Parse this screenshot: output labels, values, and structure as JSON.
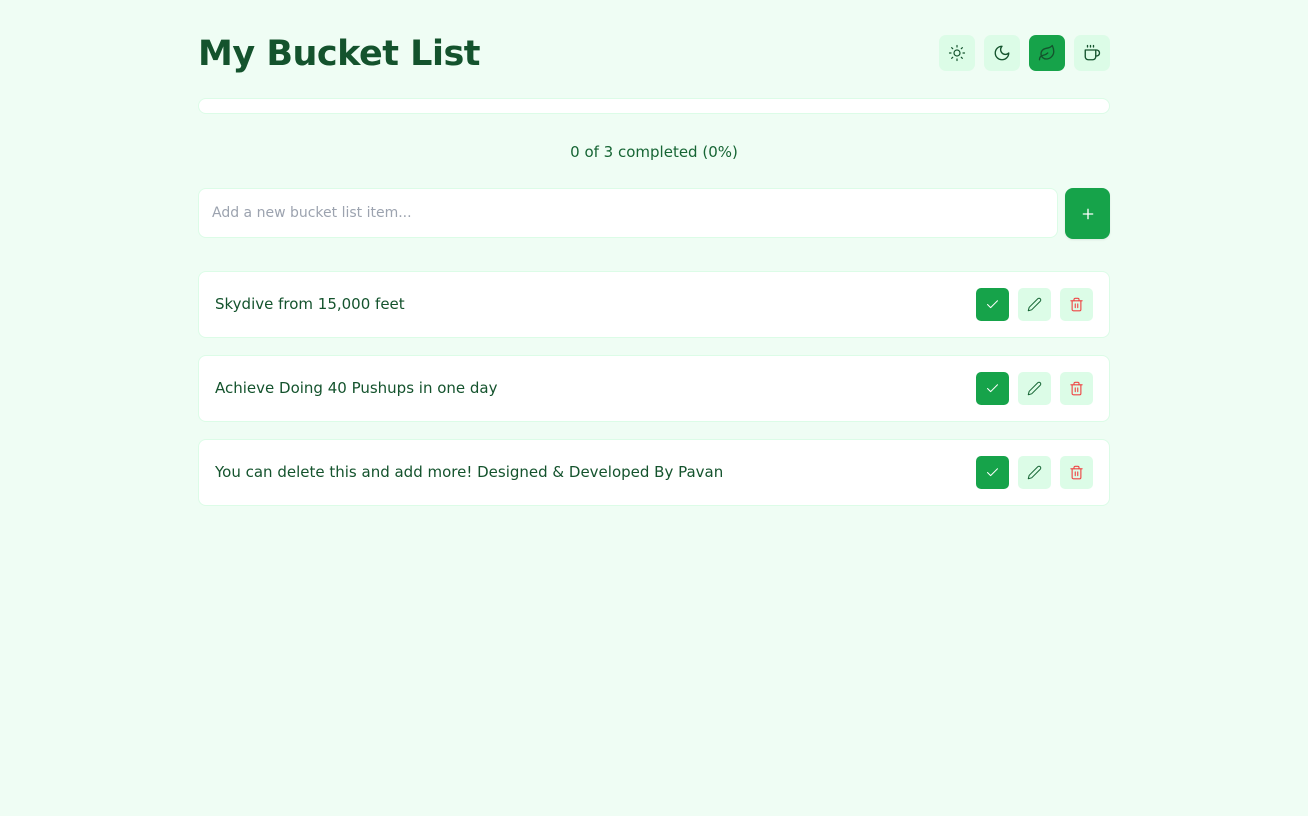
{
  "header": {
    "title": "My Bucket List",
    "themes": [
      {
        "name": "light",
        "icon": "sun-icon",
        "active": false
      },
      {
        "name": "dark",
        "icon": "moon-icon",
        "active": false
      },
      {
        "name": "nature",
        "icon": "leaf-icon",
        "active": true
      },
      {
        "name": "coffee",
        "icon": "coffee-icon",
        "active": false
      }
    ]
  },
  "progress": {
    "completed": 0,
    "total": 3,
    "percent": 0,
    "text": "0 of 3 completed (0%)"
  },
  "add": {
    "placeholder": "Add a new bucket list item...",
    "value": "",
    "button_icon": "plus-icon"
  },
  "items": [
    {
      "text": "Skydive from 15,000 feet",
      "completed": false
    },
    {
      "text": "Achieve Doing 40 Pushups in one day",
      "completed": false
    },
    {
      "text": "You can delete this and add more! Designed & Developed By Pavan",
      "completed": false
    }
  ],
  "colors": {
    "background": "#effdf4",
    "accent": "#16a34a",
    "accent_soft": "#dcfce7",
    "text": "#14532d",
    "delete": "#ef4444"
  }
}
